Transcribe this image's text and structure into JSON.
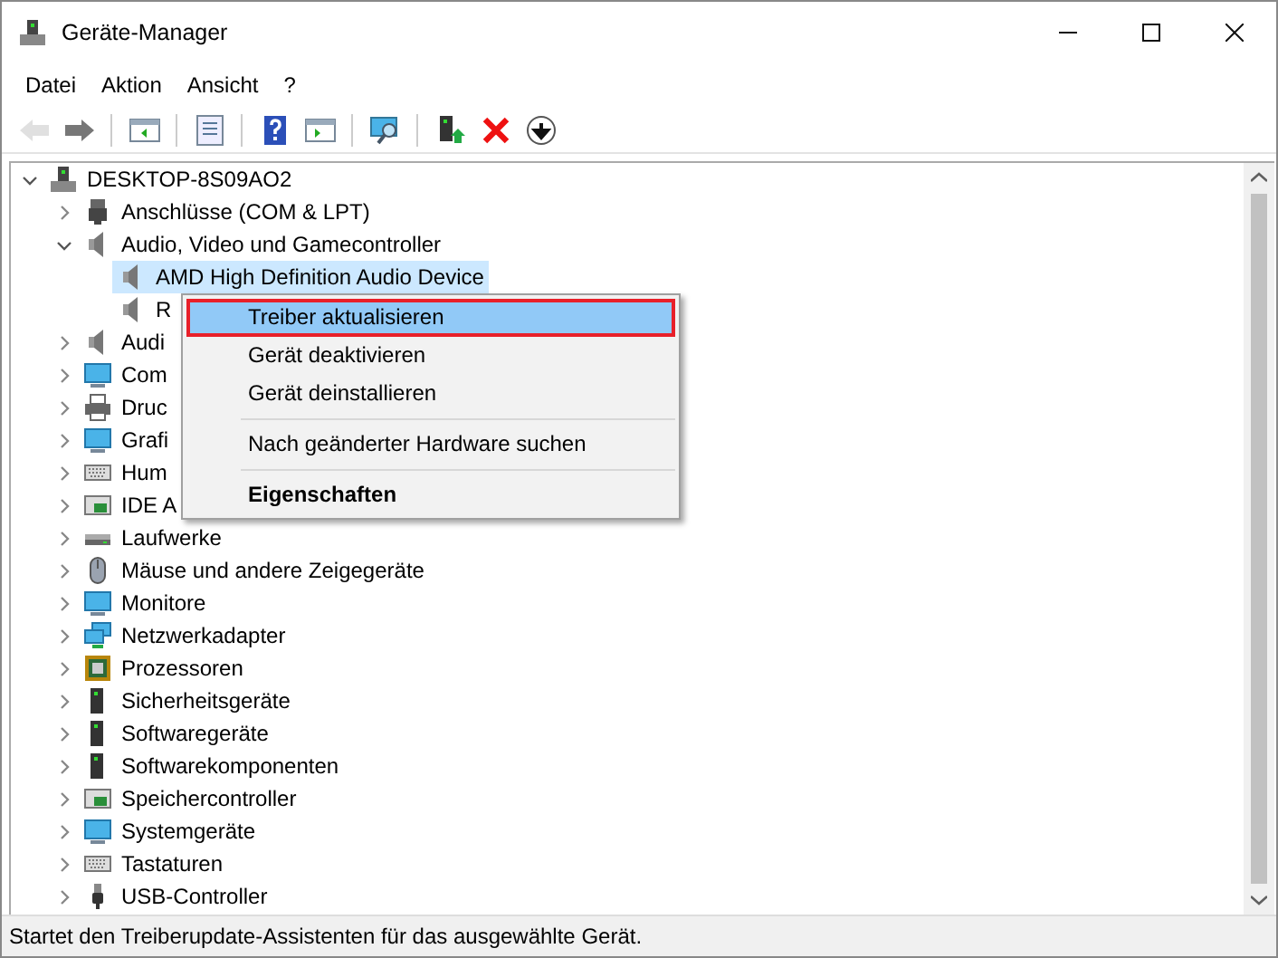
{
  "window": {
    "title": "Geräte-Manager"
  },
  "menu_bar": [
    "Datei",
    "Aktion",
    "Ansicht",
    "?"
  ],
  "toolbar": [
    {
      "kind": "back",
      "disabled": true
    },
    {
      "kind": "forward",
      "disabled": false
    },
    {
      "kind": "tree",
      "disabled": false
    },
    {
      "kind": "properties",
      "disabled": false
    },
    {
      "kind": "help",
      "disabled": false
    },
    {
      "kind": "pane",
      "disabled": false
    },
    {
      "kind": "scan",
      "disabled": false
    },
    {
      "kind": "update",
      "disabled": false
    },
    {
      "kind": "uninstall",
      "disabled": false
    },
    {
      "kind": "disable",
      "disabled": false
    }
  ],
  "tree": [
    {
      "label": "DESKTOP-8S09AO2",
      "expanded": true,
      "selected": false,
      "children": [
        {
          "label": "Anschlüsse (COM & LPT)",
          "expanded": false,
          "selected": false
        },
        {
          "label": "Audio, Video und Gamecontroller",
          "expanded": true,
          "selected": false,
          "children": [
            {
              "label": "AMD High Definition Audio Device",
              "selected": true
            },
            {
              "label": "R",
              "selected": false
            }
          ]
        },
        {
          "label": "Audi",
          "expanded": false,
          "selected": false
        },
        {
          "label": "Com",
          "expanded": false,
          "selected": false
        },
        {
          "label": "Druc",
          "expanded": false,
          "selected": false
        },
        {
          "label": "Grafi",
          "expanded": false,
          "selected": false
        },
        {
          "label": "Hum",
          "expanded": false,
          "selected": false
        },
        {
          "label": "IDE A",
          "expanded": false,
          "selected": false
        },
        {
          "label": "Laufwerke",
          "expanded": false,
          "selected": false
        },
        {
          "label": "Mäuse und andere Zeigegeräte",
          "expanded": false,
          "selected": false
        },
        {
          "label": "Monitore",
          "expanded": false,
          "selected": false
        },
        {
          "label": "Netzwerkadapter",
          "expanded": false,
          "selected": false
        },
        {
          "label": "Prozessoren",
          "expanded": false,
          "selected": false
        },
        {
          "label": "Sicherheitsgeräte",
          "expanded": false,
          "selected": false
        },
        {
          "label": "Softwaregeräte",
          "expanded": false,
          "selected": false
        },
        {
          "label": "Softwarekomponenten",
          "expanded": false,
          "selected": false
        },
        {
          "label": "Speichercontroller",
          "expanded": false,
          "selected": false
        },
        {
          "label": "Systemgeräte",
          "expanded": false,
          "selected": false
        },
        {
          "label": "Tastaturen",
          "expanded": false,
          "selected": false
        },
        {
          "label": "USB-Controller",
          "expanded": false,
          "selected": false
        }
      ]
    }
  ],
  "context_menu": [
    {
      "kind": "item",
      "label": "Treiber aktualisieren",
      "selected": true
    },
    {
      "kind": "item",
      "label": "Gerät deaktivieren",
      "selected": false
    },
    {
      "kind": "item",
      "label": "Gerät deinstallieren",
      "selected": false
    },
    {
      "kind": "separator"
    },
    {
      "kind": "item",
      "label": "Nach geänderter Hardware suchen",
      "selected": false
    },
    {
      "kind": "separator"
    },
    {
      "kind": "default",
      "label": "Eigenschaften",
      "selected": false
    }
  ],
  "status_bar": "Startet den Treiberupdate-Assistenten für das ausgewählte Gerät."
}
